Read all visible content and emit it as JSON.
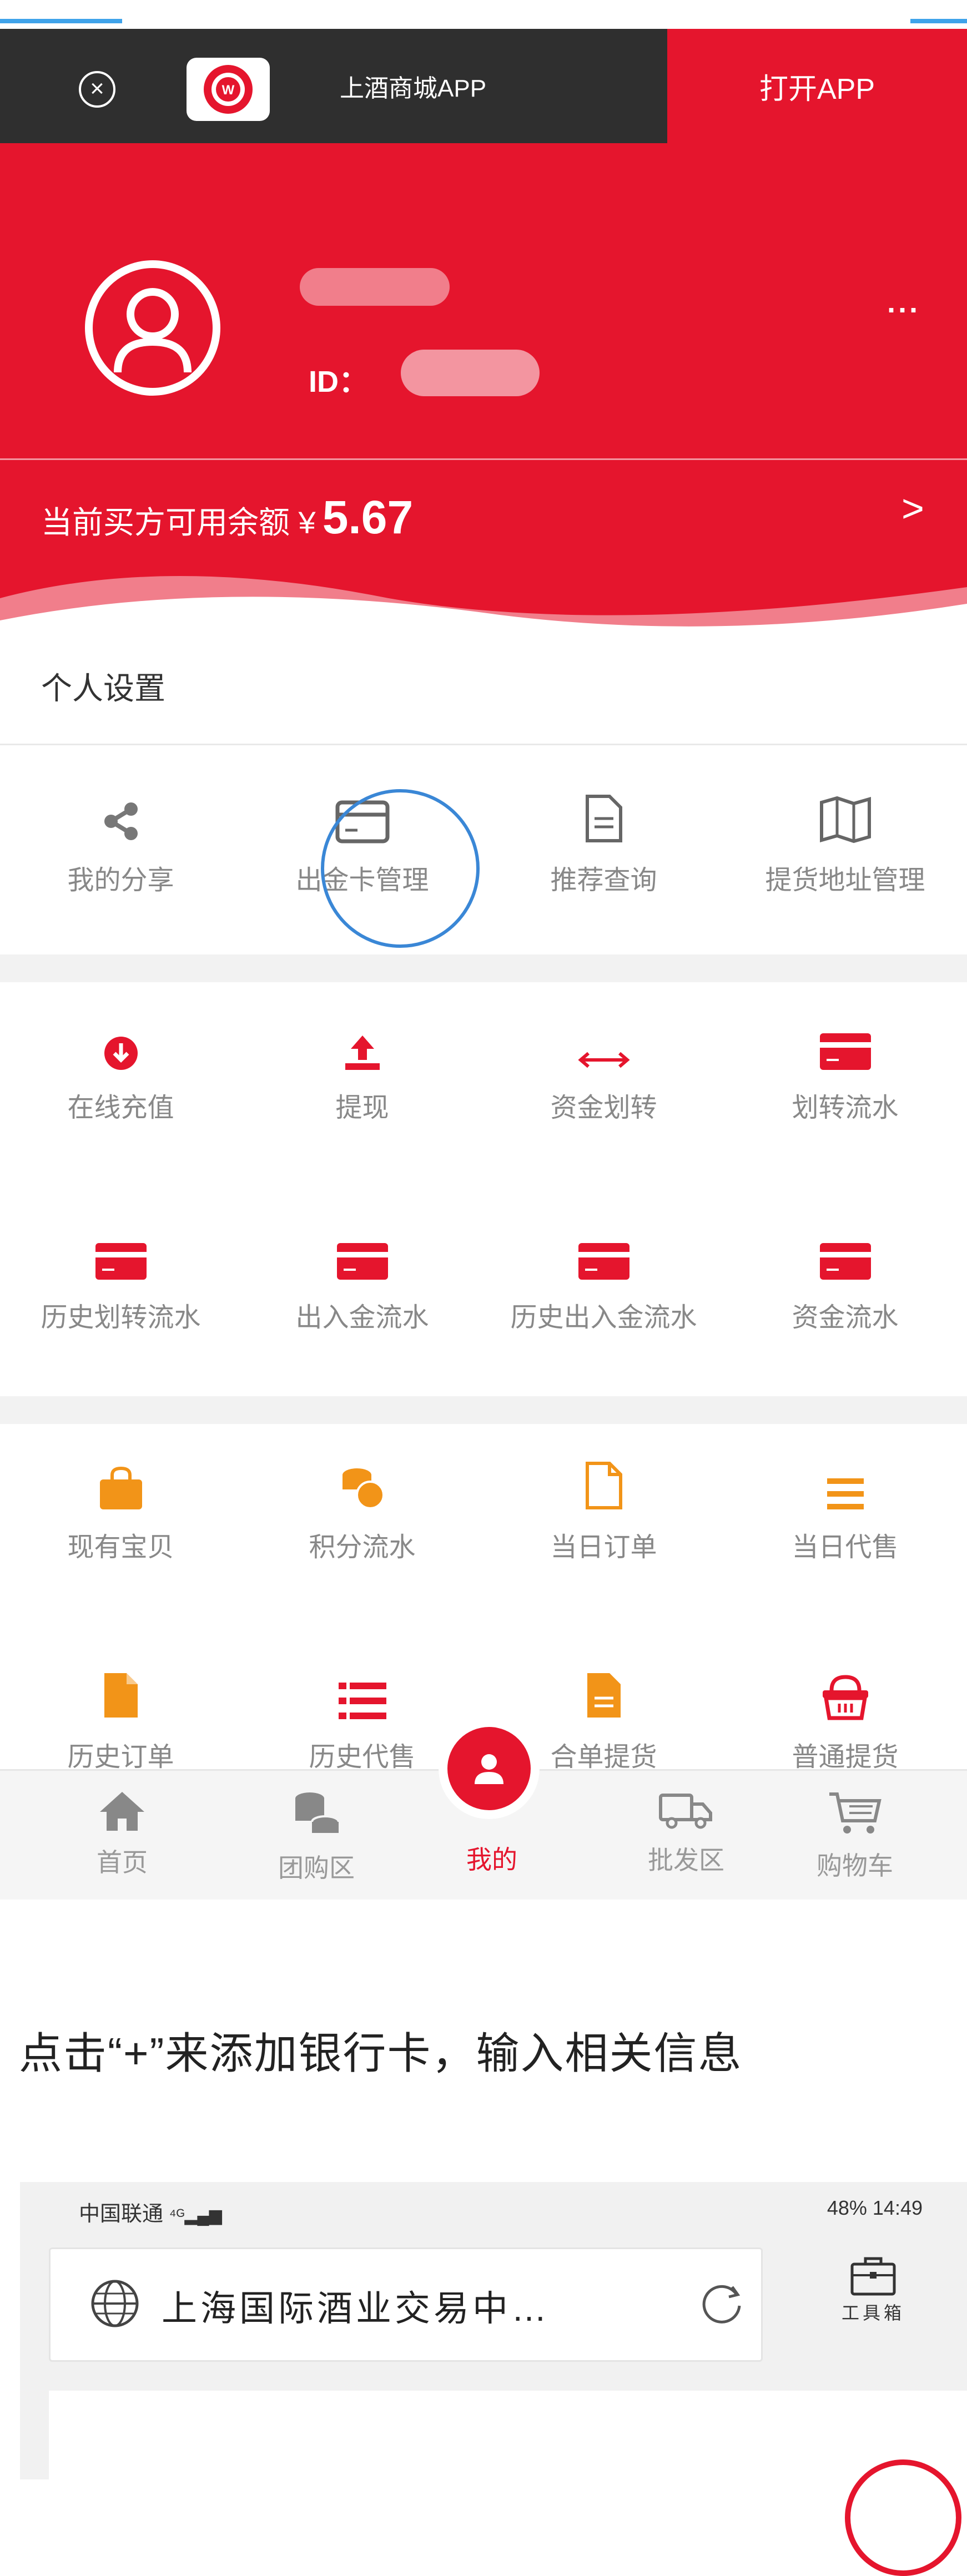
{
  "banner": {
    "title": "上酒商城APP",
    "open_label": "打开APP"
  },
  "header": {
    "id_label": "ID：",
    "more": "···",
    "balance_label": "当前买方可用余额 ¥",
    "balance_amount": "5.67",
    "arrow": ">"
  },
  "personal_settings": {
    "title": "个人设置",
    "items": [
      {
        "label": "我的分享",
        "icon": "share-icon"
      },
      {
        "label": "出金卡管理",
        "icon": "card-icon"
      },
      {
        "label": "推荐查询",
        "icon": "document-icon"
      },
      {
        "label": "提货地址管理",
        "icon": "map-icon"
      }
    ]
  },
  "funds": {
    "items": [
      {
        "label": "在线充值",
        "icon": "download-circle-icon"
      },
      {
        "label": "提现",
        "icon": "upload-icon"
      },
      {
        "label": "资金划转",
        "icon": "transfer-arrows-icon"
      },
      {
        "label": "划转流水",
        "icon": "card-icon"
      },
      {
        "label": "历史划转流水",
        "icon": "card-icon"
      },
      {
        "label": "出入金流水",
        "icon": "card-icon"
      },
      {
        "label": "历史出入金流水",
        "icon": "card-icon"
      },
      {
        "label": "资金流水",
        "icon": "card-icon"
      }
    ]
  },
  "orders": {
    "items": [
      {
        "label": "现有宝贝",
        "icon": "bag-icon"
      },
      {
        "label": "积分流水",
        "icon": "coins-icon"
      },
      {
        "label": "当日订单",
        "icon": "file-icon"
      },
      {
        "label": "当日代售",
        "icon": "list-icon"
      },
      {
        "label": "历史订单",
        "icon": "file-icon"
      },
      {
        "label": "历史代售",
        "icon": "list-icon"
      },
      {
        "label": "合单提货",
        "icon": "file-icon"
      },
      {
        "label": "普通提货",
        "icon": "basket-icon"
      }
    ]
  },
  "bottom_nav": {
    "items": [
      {
        "label": "首页",
        "icon": "home-icon"
      },
      {
        "label": "团购区",
        "icon": "database-icon"
      },
      {
        "label": "我的",
        "icon": "user-icon"
      },
      {
        "label": "批发区",
        "icon": "truck-icon"
      },
      {
        "label": "购物车",
        "icon": "cart-icon"
      }
    ],
    "active": "我的"
  },
  "instruction": "点击“+”来添加银行卡，输入相关信息",
  "phone": {
    "carrier": "中国联通",
    "status_right": "48%  14:49",
    "url": "上海国际酒业交易中…",
    "toolbox_label": "工具箱"
  },
  "colors": {
    "brand_red": "#e5152d",
    "highlight_blue": "#3a87d6",
    "dark_bar": "#2f2f2f"
  }
}
